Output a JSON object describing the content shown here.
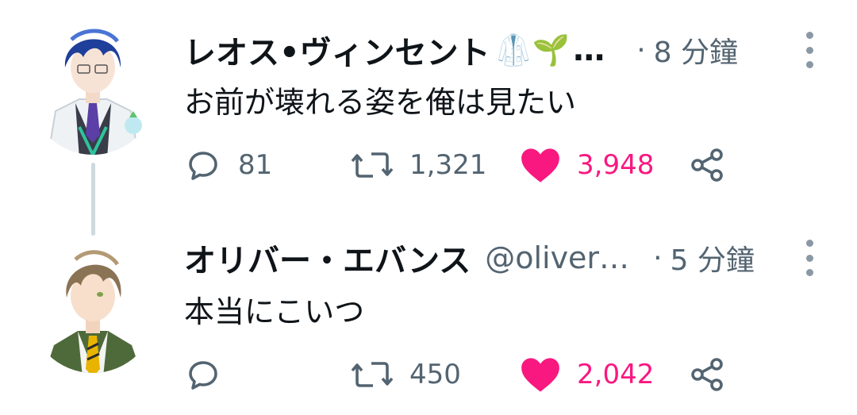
{
  "tweets": [
    {
      "author_name": "レオス•ヴィンセント",
      "emojis": "🥼🌱",
      "ellipsis": "…",
      "separator": "·",
      "time": "8 分鐘",
      "text": "お前が壊れる姿を俺は見たい",
      "replies": "81",
      "retweets": "1,321",
      "likes": "3,948",
      "liked": true
    },
    {
      "author_name": "オリバー・エバンス",
      "handle": "@oliver…",
      "separator": "·",
      "time": "5 分鐘",
      "text": "本当にこいつ",
      "replies": "",
      "retweets": "450",
      "likes": "2,042",
      "liked": true
    }
  ],
  "colors": {
    "like": "#f91880",
    "secondary_text": "#536471",
    "thread_line": "#cfd9de"
  },
  "icons": [
    "reply-icon",
    "retweet-icon",
    "like-heart-icon",
    "share-icon",
    "more-options-icon"
  ]
}
